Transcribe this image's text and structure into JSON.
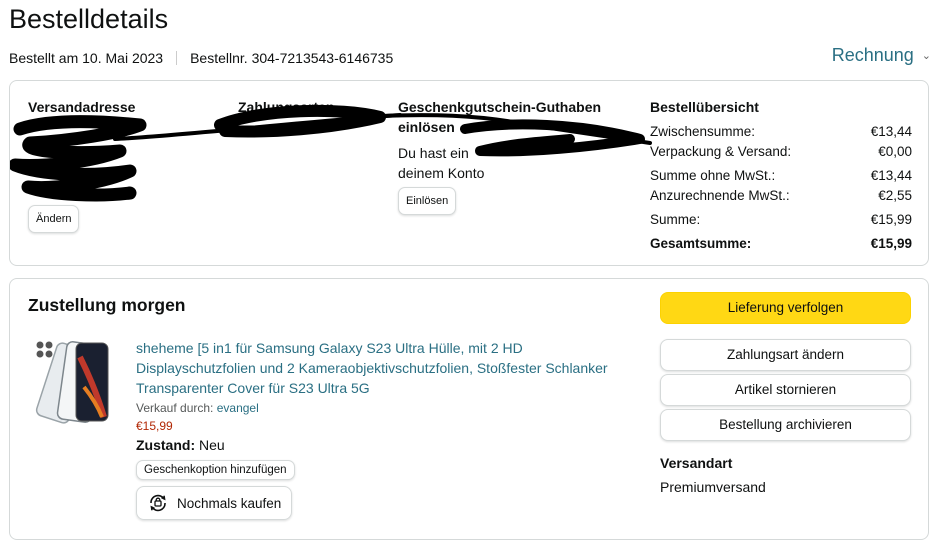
{
  "header": {
    "title": "Bestelldetails",
    "ordered_on": "Bestellt am 10. Mai 2023",
    "order_number": "Bestellnr. 304-7213543-6146735",
    "invoice_label": "Rechnung"
  },
  "summary": {
    "address": {
      "heading": "Versandadresse",
      "change_label": "Ändern"
    },
    "payment": {
      "heading": "Zahlungsarten"
    },
    "gift": {
      "heading": "Geschenkgutschein-Guthaben einlösen",
      "text_line1": "Du hast ein",
      "text_line2": "deinem Konto",
      "redeem_label": "Einlösen"
    },
    "overview": {
      "heading": "Bestellübersicht",
      "rows": [
        {
          "label": "Zwischensumme:",
          "value": "€13,44"
        },
        {
          "label": "Verpackung & Versand:",
          "value": "€0,00"
        },
        {
          "label": "Summe ohne MwSt.:",
          "value": "€13,44"
        },
        {
          "label": "Anzurechnende MwSt.:",
          "value": "€2,55"
        },
        {
          "label": "Summe:",
          "value": "€15,99"
        }
      ],
      "total": {
        "label": "Gesamtsumme:",
        "value": "€15,99"
      }
    }
  },
  "delivery": {
    "status": "Zustellung morgen",
    "product": {
      "title": "sheheme [5 in1 für Samsung Galaxy S23 Ultra Hülle, mit 2 HD Displayschutzfolien und 2 Kameraobjektivschutzfolien, Stoßfester Schlanker Transparenter Cover für S23 Ultra 5G",
      "seller_prefix": "Verkauf durch:",
      "seller": "evangel",
      "price": "€15,99",
      "condition_label": "Zustand:",
      "condition": "Neu",
      "gift_option_label": "Geschenkoption hinzufügen",
      "buy_again_label": "Nochmals kaufen"
    },
    "actions": {
      "track": "Lieferung verfolgen",
      "change_payment": "Zahlungsart ändern",
      "cancel": "Artikel stornieren",
      "archive": "Bestellung archivieren"
    },
    "shipping": {
      "heading": "Versandart",
      "value": "Premiumversand"
    }
  },
  "colors": {
    "link": "#2a6f83",
    "primary_button": "#ffd814",
    "price": "#b12704",
    "redaction": "#000000"
  }
}
